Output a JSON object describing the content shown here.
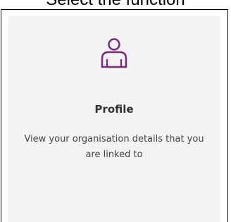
{
  "page": {
    "top_text": "Select the function"
  },
  "card": {
    "icon": "person-outline-icon",
    "title": "Profile",
    "description": "View your organisation details that you are linked to"
  },
  "colors": {
    "icon_accent": "#7a2a7c",
    "card_background": "#f3f3f3",
    "title_text": "#333333",
    "body_text": "#444444"
  }
}
